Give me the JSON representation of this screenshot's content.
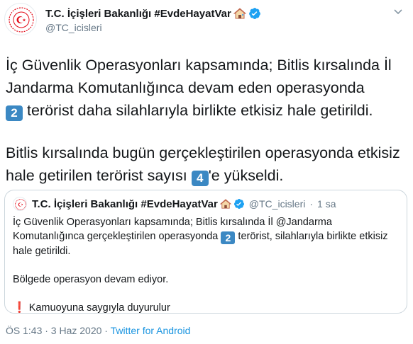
{
  "header": {
    "name": "T.C. İçişleri Bakanlığı #EvdeHayatVar",
    "handle": "@TC_icisleri",
    "house_emoji_icon": "house-icon",
    "verified_icon": "verified-badge-icon",
    "menu_icon": "chevron-down-icon"
  },
  "tweet": {
    "line1": "İç Güvenlik Operasyonları kapsamında; Bitlis kırsalında İl Jandarma Komutanlığınca devam eden operasyonda",
    "count_a": "2",
    "line1_end": " terörist daha  silahlarıyla birlikte etkisiz hale getirildi.",
    "line2": "Bitlis kırsalında bugün gerçekleştirilen operasyonda etkisiz hale getirilen terörist sayısı ",
    "count_b": "4",
    "line2_end": "'e yükseldi."
  },
  "quote": {
    "name": "T.C. İçişleri Bakanlığı #EvdeHayatVar",
    "handle": "@TC_icisleri",
    "separator": "·",
    "time": "1 sa",
    "p1_start": "İç Güvenlik Operasyonları kapsamında; Bitlis kırsalında İl @Jandarma Komutanlığınca gerçekleştirilen operasyonda ",
    "count": "2",
    "p1_end": " terörist, silahlarıyla birlikte etkisiz hale getirildi.",
    "p2": "Bölgede operasyon devam ediyor.",
    "p3": "Kamuoyuna saygıyla duyurulur",
    "exclamation": "❗"
  },
  "footer": {
    "timestamp": "ÖS 1:43 · 3 Haz 2020 · ",
    "source": "Twitter for Android"
  },
  "colors": {
    "accent": "#1b95e0",
    "keycap": "#3b88c3",
    "muted": "#657786",
    "crest_red": "#e30a17"
  }
}
